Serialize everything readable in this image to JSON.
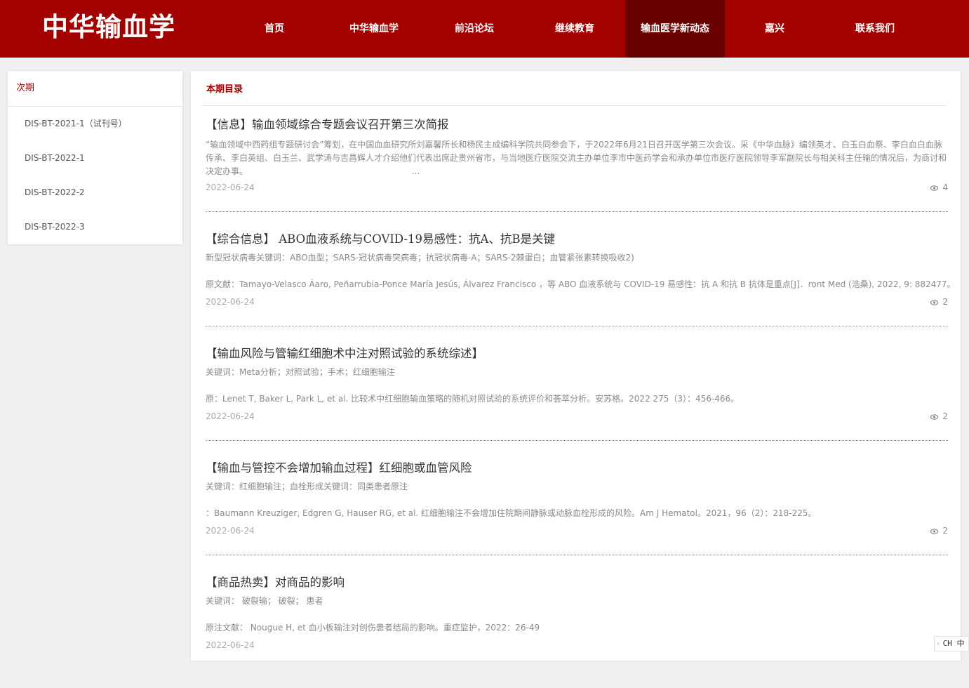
{
  "header": {
    "logo": "中华输血学",
    "nav": [
      {
        "label": "首页",
        "active": false
      },
      {
        "label": "中华输血学",
        "active": false
      },
      {
        "label": "前沿论坛",
        "active": false
      },
      {
        "label": "继续教育",
        "active": false
      },
      {
        "label": "输血医学新动态",
        "active": true
      },
      {
        "label": "嘉兴",
        "active": false
      },
      {
        "label": "联系我们",
        "active": false
      }
    ]
  },
  "sidebar": {
    "title": "次期",
    "items": [
      {
        "label": "DIS-BT-2021-1（试刊号）"
      },
      {
        "label": "DIS-BT-2022-1"
      },
      {
        "label": "DIS-BT-2022-2"
      },
      {
        "label": "DIS-BT-2022-3"
      }
    ]
  },
  "main": {
    "title": "本期目录",
    "articles": [
      {
        "title": "【信息】输血领域综合专题会议召开第三次简报",
        "summary": "“输血领域中西药组专题研讨会”筹划，在中国血血研究所刘嘉馨所长和杨民主成编科学院共同参会下，于2022年6月21日召开医学第三次会议。采《中华血脉》编领英才、白玉白血祭、李白血白血脉传承、李白英组、白玉兰、武学涛与吉昌辉人才介绍他们代表出席赴贵州省市，与当地医疗医院交流主办单位李市中医药学会和承办单位市医疗医院领导李军副院长与相关科主任输的情况后，为商讨和决定办事。",
        "ellipsis": "...",
        "date": "2022-06-24",
        "views": "4"
      },
      {
        "title": "【综合信息】 ABO血液系统与COVID-19易感性：抗A、抗B是关键",
        "line1": "新型冠状病毒关键词：ABO血型；SARS-冠状病毒突病毒；抗冠状病毒-A；SARS-2棘蛋白；血管紧张素转换吸收2)",
        "line2": "原文献：Tamayo-Velasco Áaro, Peñarrubia-Ponce María Jesús, Álvarez Francisco ，等 ABO 血液系统与 COVID-19 易感性：抗 A 和抗 B 抗体是重点[J]．ront Med (浩桑), 2022, 9: 882477。",
        "date": "2022-06-24",
        "views": "2"
      },
      {
        "title": "【输血风险与管输红细胞术中注对照试验的系统综述】",
        "line1": "关键词：Meta分析；对照试验；手术；红细胞输注",
        "line2": "原：Lenet T, Baker L, Park L, et al. 比较术中红细胞输血策略的随机对照试验的系统评价和荟萃分析。安苏格。2022 275（3）：456-466。",
        "date": "2022-06-24",
        "views": "2"
      },
      {
        "title": "【输血与管控不会增加输血过程】红细胞或血管风险",
        "line1": "关键词：红细胞输注；血栓形成关键词：同类患者原注",
        "line2": "：Baumann Kreuziger, Edgren G, Hauser RG, et al. 红细胞输注不会增加住院期间静脉或动脉血栓形成的风险。Am J Hematol。2021，96（2）：218-225。",
        "date": "2022-06-24",
        "views": "2"
      },
      {
        "title": "【商品热卖】对商品的影响",
        "line1": "关键词： 破裂输； 破裂； 患者",
        "line2": "原注文献： Nougue H, et 血小板输注对创伤患者结局的影响。重症监护，2022：26-49",
        "date": "2022-06-24",
        "views": ""
      }
    ]
  },
  "lang_badge": {
    "chevron": "‹",
    "label": "CH 中"
  },
  "colors": {
    "brand": "#a30000",
    "nav_active": "#6a0000",
    "background": "#f0f0f0"
  }
}
